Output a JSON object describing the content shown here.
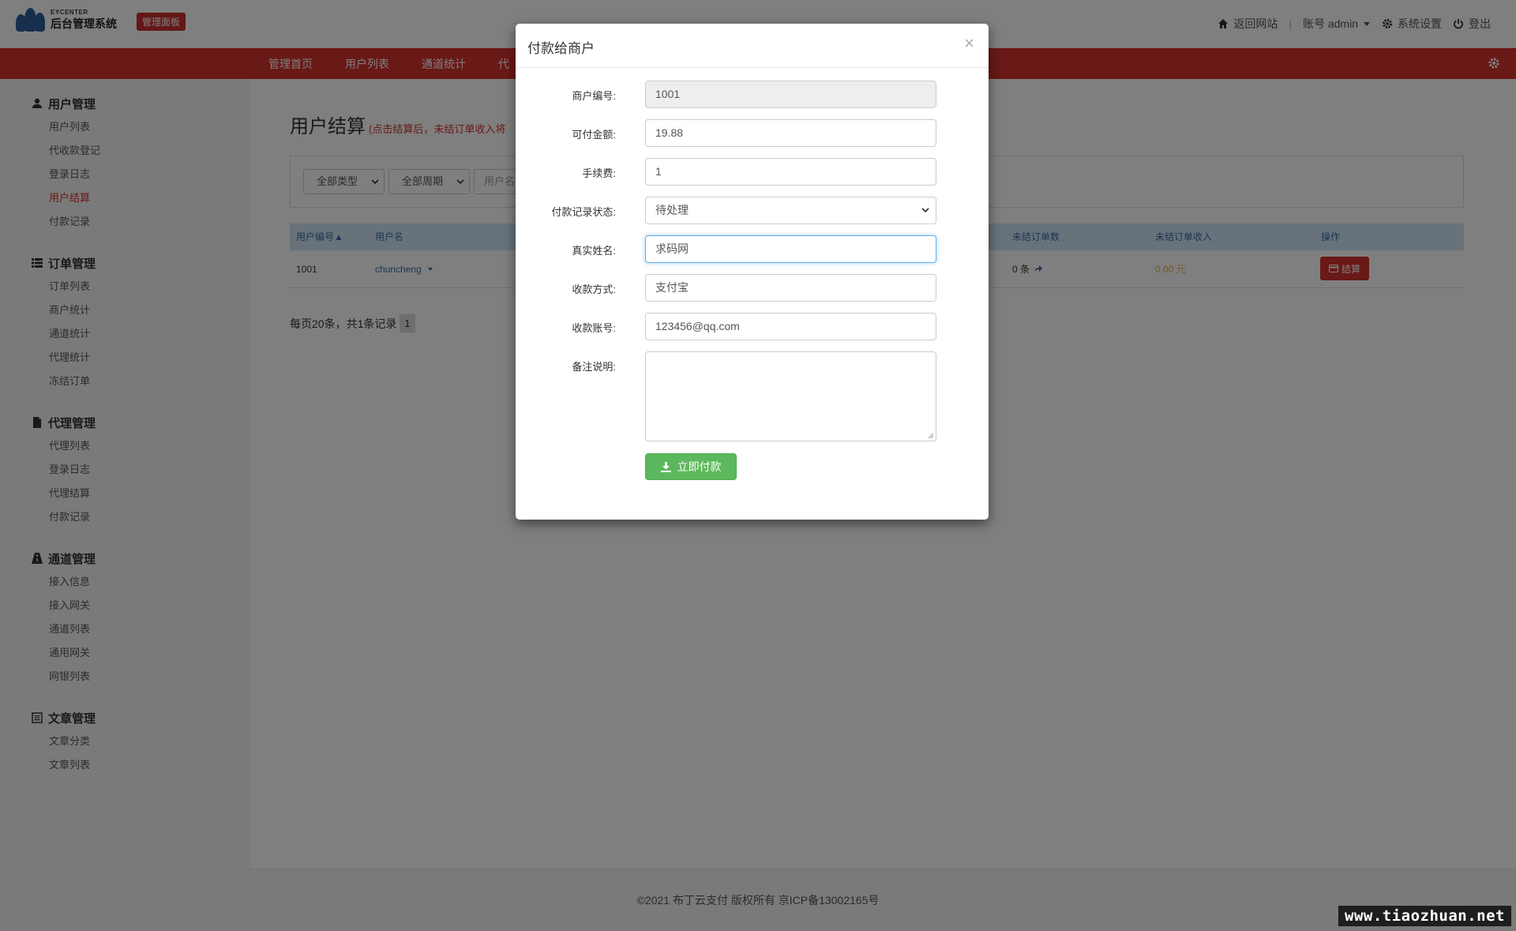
{
  "header": {
    "logo_small": "EYCENTER",
    "logo_big": "后台管理系统",
    "badge": "管理面板",
    "back_to_site": "返回网站",
    "account": "账号 admin",
    "settings": "系统设置",
    "logout": "登出"
  },
  "nav": {
    "items": [
      "管理首页",
      "用户列表",
      "通道统计",
      "代"
    ]
  },
  "sidebar": {
    "groups": [
      {
        "title": "用户管理",
        "icon": "user-icon",
        "items": [
          "用户列表",
          "代收款登记",
          "登录日志",
          "用户结算",
          "付款记录"
        ]
      },
      {
        "title": "订单管理",
        "icon": "list-icon",
        "items": [
          "订单列表",
          "商户统计",
          "通道统计",
          "代理统计",
          "冻结订单"
        ]
      },
      {
        "title": "代理管理",
        "icon": "file-icon",
        "items": [
          "代理列表",
          "登录日志",
          "代理结算",
          "付款记录"
        ]
      },
      {
        "title": "通道管理",
        "icon": "road-icon",
        "items": [
          "接入信息",
          "接入网关",
          "通道列表",
          "通用网关",
          "网银列表"
        ]
      },
      {
        "title": "文章管理",
        "icon": "article-icon",
        "items": [
          "文章分类",
          "文章列表"
        ]
      }
    ],
    "active_item": "用户结算"
  },
  "main": {
    "title": "用户结算",
    "title_note": "(点击结算后，未结订单收入将",
    "filters": {
      "type": "全部类型",
      "period": "全部周期",
      "username_placeholder": "用户名"
    },
    "table": {
      "headers": [
        "用户编号▲",
        "用户名",
        "未结订单数",
        "未结订单收入",
        "操作"
      ],
      "rows": [
        {
          "id": "1001",
          "username": "chuncheng",
          "unsettled_count": "0 条",
          "unsettled_income": "0.00 元",
          "action": "结算"
        }
      ]
    },
    "pager": {
      "summary": "每页20条，共1条记录",
      "current_page": "1"
    }
  },
  "modal": {
    "title": "付款给商户",
    "close": "×",
    "fields": {
      "merchant_id_label": "商户编号:",
      "merchant_id_value": "1001",
      "payable_label": "可付金额:",
      "payable_value": "19.88",
      "fee_label": "手续费:",
      "fee_value": "1",
      "status_label": "付款记录状态:",
      "status_value": "待处理",
      "realname_label": "真实姓名:",
      "realname_value": "求码网",
      "method_label": "收款方式:",
      "method_value": "支付宝",
      "account_label": "收款账号:",
      "account_value": "123456@qq.com",
      "remark_label": "备注说明:",
      "remark_value": ""
    },
    "submit": "立即付款"
  },
  "footer": {
    "text": "©2021  布丁云支付  版权所有  京ICP备13002165号"
  },
  "watermark": "www.tiaozhuan.net",
  "colors": {
    "brand_red": "#d2322d",
    "success_green": "#5cb85c",
    "table_head": "#d0e4f5",
    "income_orange": "#f0ad4e"
  }
}
